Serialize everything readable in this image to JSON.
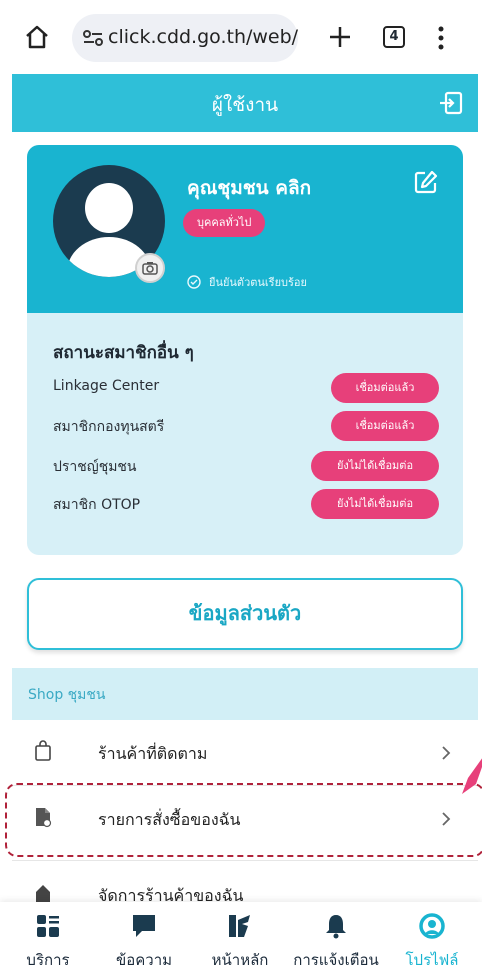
{
  "browser": {
    "url": "click.cdd.go.th/web/",
    "tab_count": "4"
  },
  "header": {
    "title": "ผู้ใช้งาน"
  },
  "profile": {
    "name": "คุณชุมชน คลิก",
    "badge": "บุคคลทั่วไป",
    "verified_text": "ยืนยันตัวตนเรียบร้อย"
  },
  "membership": {
    "title": "สถานะสมาชิกอื่น ๆ",
    "items": [
      {
        "label": "Linkage Center",
        "status": "เชื่อมต่อแล้ว"
      },
      {
        "label": "สมาชิกกองทุนสตรี",
        "status": "เชื่อมต่อแล้ว"
      },
      {
        "label": "ปราชญ์ชุมชน",
        "status": "ยังไม่ได้เชื่อมต่อ"
      },
      {
        "label": "สมาชิก OTOP",
        "status": "ยังไม่ได้เชื่อมต่อ"
      }
    ]
  },
  "personal_info": {
    "label": "ข้อมูลส่วนตัว"
  },
  "shop": {
    "title": "Shop ชุมชน",
    "items": [
      {
        "label": "ร้านค้าที่ติดตาม",
        "icon": "shopping-bag-icon"
      },
      {
        "label": "รายการสั่งซื้อของฉัน",
        "icon": "order-list-icon"
      },
      {
        "label": "จัดการร้านค้าของฉัน",
        "icon": "store-icon"
      }
    ]
  },
  "bottom_nav": {
    "items": [
      {
        "label": "บริการ",
        "icon": "services-grid-icon"
      },
      {
        "label": "ข้อความ",
        "icon": "message-icon"
      },
      {
        "label": "หน้าหลัก",
        "icon": "home-logo-icon"
      },
      {
        "label": "การแจ้งเตือน",
        "icon": "bell-icon"
      },
      {
        "label": "โปรไฟล์",
        "icon": "profile-icon"
      }
    ]
  },
  "colors": {
    "accent": "#2fbfd8",
    "profile_bg": "#19b4d0",
    "badge_pink": "#e7407a",
    "highlight_dashed": "#b0223a"
  }
}
